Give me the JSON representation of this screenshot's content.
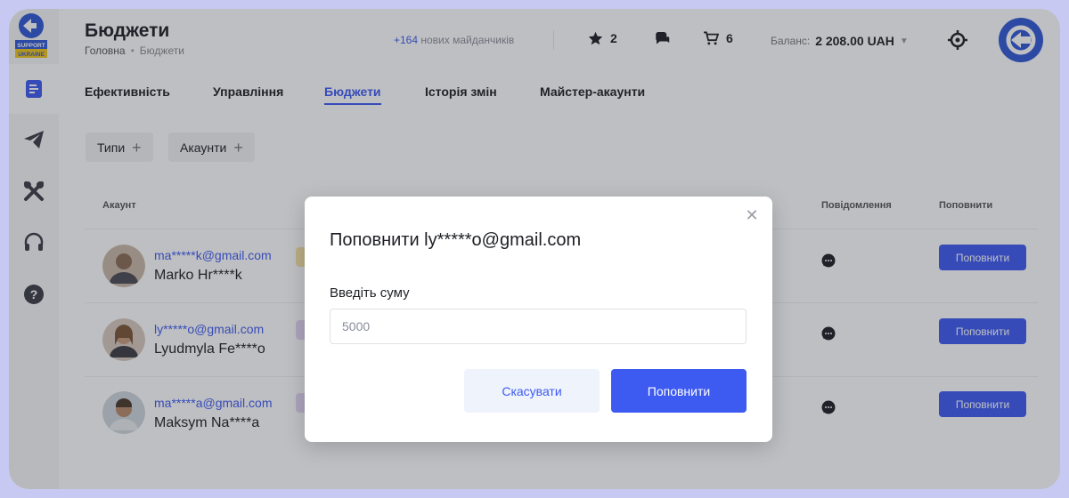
{
  "header": {
    "title": "Бюджети",
    "breadcrumb": [
      "Головна",
      "Бюджети"
    ],
    "new_sites_count": "+164",
    "new_sites_label": "нових майданчиків",
    "favorites_count": "2",
    "cart_count": "6",
    "balance_label": "Баланс:",
    "balance_value": "2 208.00 UAH"
  },
  "logo_text": [
    "SUPPORT",
    "UKRAINE"
  ],
  "tabs": [
    {
      "label": "Ефективність"
    },
    {
      "label": "Управління"
    },
    {
      "label": "Бюджети"
    },
    {
      "label": "Історія змін"
    },
    {
      "label": "Майстер-акаунти"
    }
  ],
  "active_tab": "Бюджети",
  "filters": {
    "types": "Типи",
    "accounts": "Акаунти"
  },
  "table": {
    "columns": {
      "account": "Акаунт",
      "messages": "Повідомлення",
      "topup": "Поповнити"
    },
    "rows": [
      {
        "email": "ma*****k@gmail.com",
        "name": "Marko Hr****k",
        "tag_color": "#f7e6a6",
        "topup_label": "Поповнити"
      },
      {
        "email": "ly*****o@gmail.com",
        "name": "Lyudmyla Fe****o",
        "tag_color": "#e6d9f7",
        "topup_label": "Поповнити"
      },
      {
        "email": "ma*****a@gmail.com",
        "name": "Maksym Na****a",
        "tag_color": "#e6d9f7",
        "topup_label": "Поповнити"
      }
    ]
  },
  "modal": {
    "title": "Поповнити ly*****o@gmail.com",
    "amount_label": "Введіть суму",
    "amount_placeholder": "5000",
    "cancel_label": "Скасувати",
    "submit_label": "Поповнити"
  },
  "colors": {
    "accent": "#3d5af1",
    "cancel_bg": "#eef3fc"
  }
}
